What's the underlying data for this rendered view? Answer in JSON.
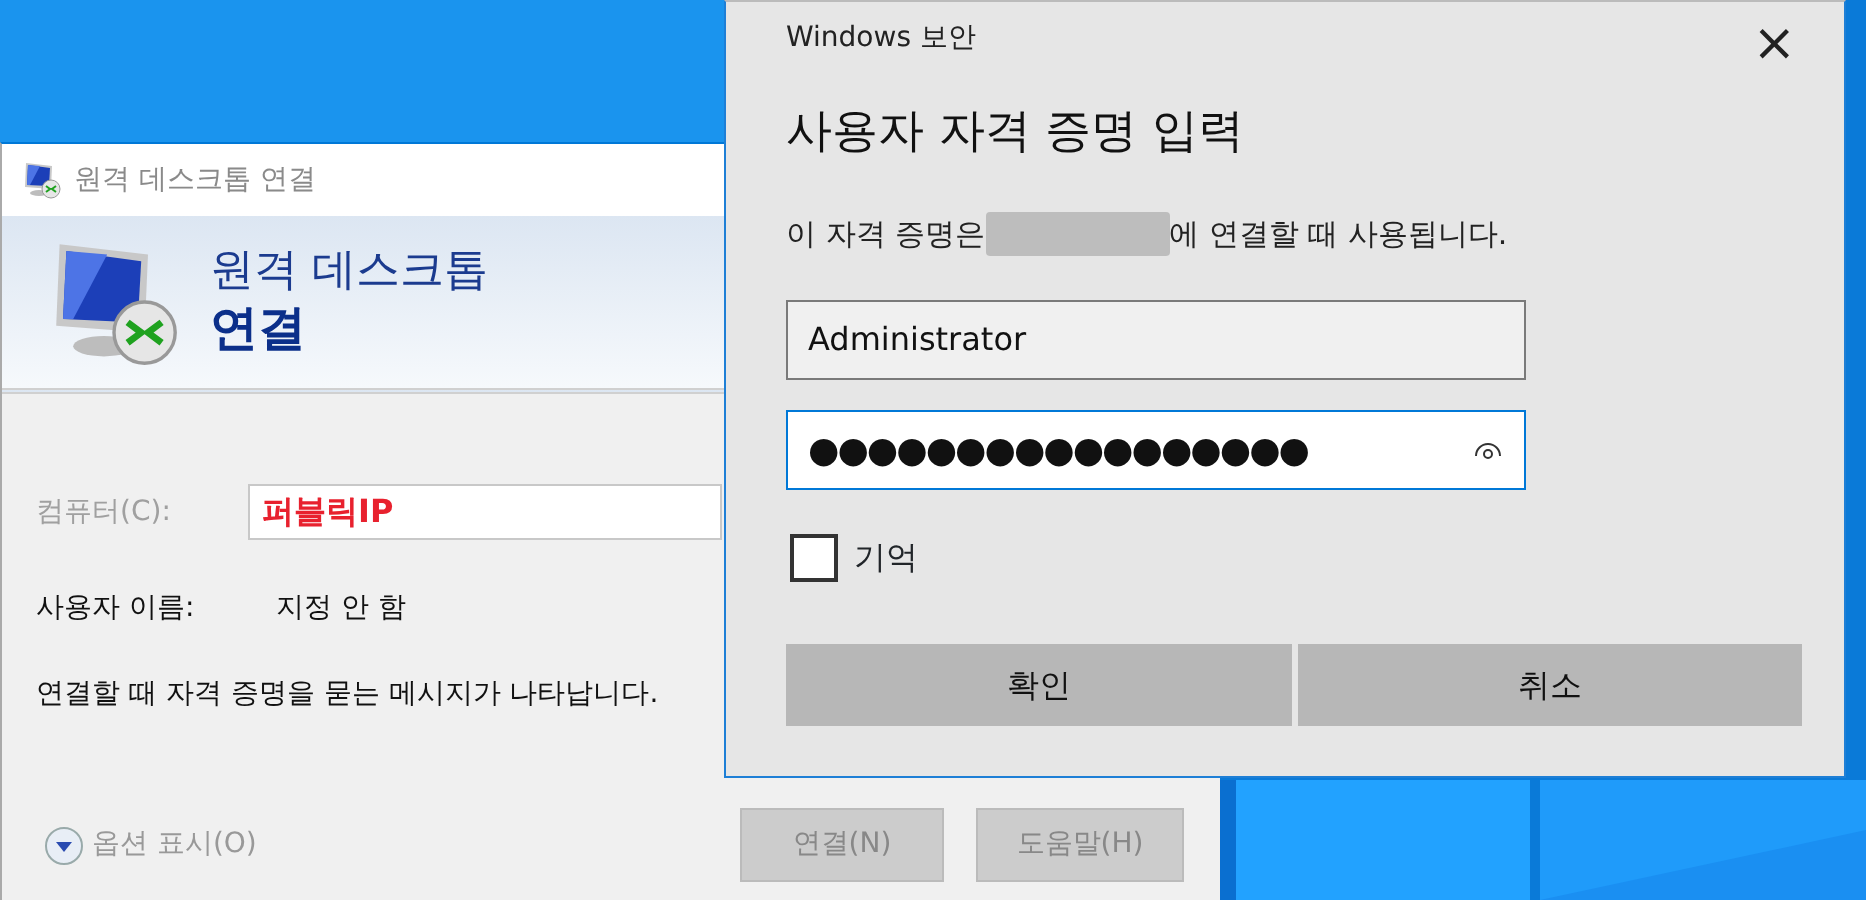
{
  "rdp_window": {
    "title": "원격 데스크톱 연결",
    "header_line1": "원격 데스크톱",
    "header_line2": "연결",
    "computer": {
      "label": "컴퓨터(C):",
      "value": "퍼블릭IP",
      "disabled": true
    },
    "username": {
      "label": "사용자 이름:",
      "value": "지정 안 함"
    },
    "message": "연결할 때 자격 증명을 묻는 메시지가 나타납니다.",
    "options": {
      "label": "옵션 표시(O)",
      "disabled": true
    },
    "buttons": [
      {
        "label": "연결(N)",
        "disabled": true
      },
      {
        "label": "도움말(H)",
        "disabled": true
      }
    ]
  },
  "security_dialog": {
    "title": "Windows 보안",
    "close": "×",
    "heading": "사용자 자격 증명 입력",
    "description_before": "이 자격 증명은",
    "description_after": "에 연결할 때 사용됩니다.",
    "username_field": {
      "value": "Administrator",
      "focused": false
    },
    "password_field": {
      "value": "●●●●●●●●●●●●●●●●●",
      "focused": true
    },
    "remember": {
      "label": "기억",
      "checked": false
    },
    "buttons": [
      {
        "label": "확인"
      },
      {
        "label": "취소"
      }
    ]
  }
}
